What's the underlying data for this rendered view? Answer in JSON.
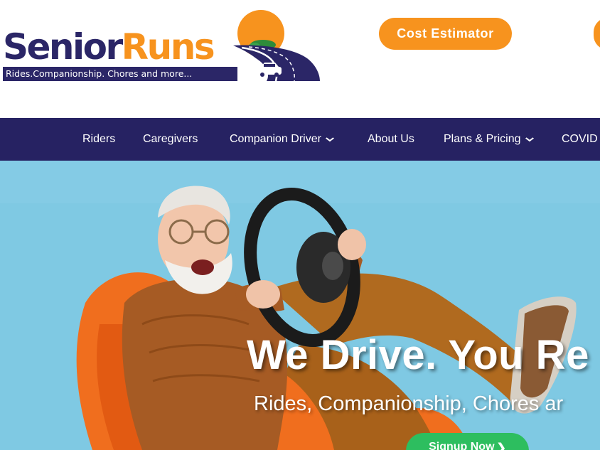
{
  "header": {
    "logo": {
      "word_part1": "Senior",
      "word_part2": "Runs",
      "tagline": "Rides.Companionship. Chores and more..."
    },
    "cost_estimator_label": "Cost Estimator"
  },
  "nav": {
    "items": [
      {
        "label": "Riders",
        "has_dropdown": false
      },
      {
        "label": "Caregivers",
        "has_dropdown": false
      },
      {
        "label": "Companion Driver",
        "has_dropdown": true
      },
      {
        "label": "About Us",
        "has_dropdown": false
      },
      {
        "label": "Plans & Pricing",
        "has_dropdown": true
      },
      {
        "label": "COVID",
        "has_dropdown": false
      }
    ],
    "chevron_glyph": "⌄"
  },
  "hero": {
    "title": "We Drive. You Re",
    "subtitle": "Rides, Companionship, Chores ar",
    "signup_label": "Signup Now",
    "signup_arrow": "❯"
  },
  "colors": {
    "brand_navy": "#262262",
    "brand_orange": "#f7931e",
    "signup_green": "#2dbe5f",
    "hero_background": "#7fc9e3"
  },
  "icons": [
    "sun-icon",
    "car-icon",
    "road-icon",
    "chevron-down-icon",
    "arrow-right-icon"
  ]
}
